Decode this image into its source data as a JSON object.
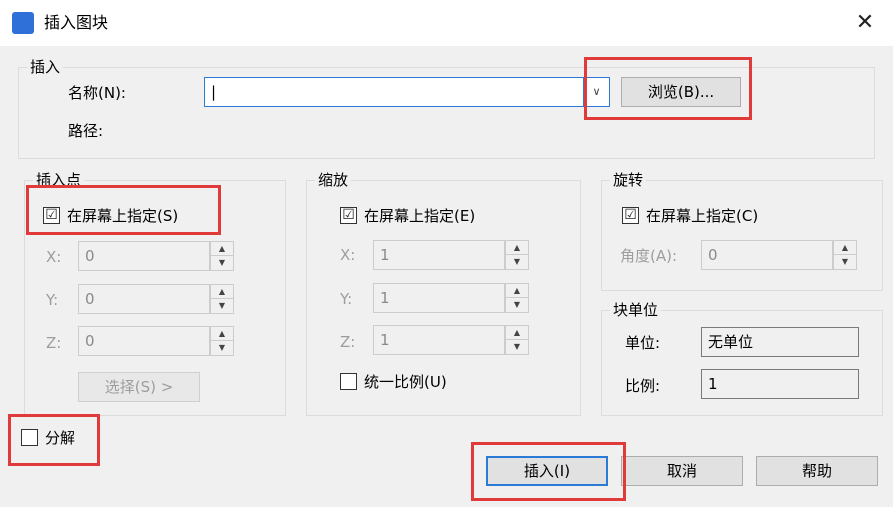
{
  "window": {
    "title": "插入图块",
    "close_glyph": "✕"
  },
  "insert_group": {
    "legend": "插入",
    "name_label": "名称(N):",
    "name_value": "|",
    "browse_label": "浏览(B)...",
    "path_label": "路径:"
  },
  "insert_point": {
    "legend": "插入点",
    "on_screen_label": "在屏幕上指定(S)",
    "on_screen_checked": "☑",
    "x_label": "X:",
    "x_value": "0",
    "y_label": "Y:",
    "y_value": "0",
    "z_label": "Z:",
    "z_value": "0",
    "select_label": "选择(S) >"
  },
  "scale": {
    "legend": "缩放",
    "on_screen_label": "在屏幕上指定(E)",
    "x_label": "X:",
    "x_value": "1",
    "y_label": "Y:",
    "y_value": "1",
    "z_label": "Z:",
    "z_value": "1",
    "uniform_label": "统一比例(U)"
  },
  "rotation": {
    "legend": "旋转",
    "on_screen_label": "在屏幕上指定(C)",
    "angle_label": "角度(A):",
    "angle_value": "0"
  },
  "block_unit": {
    "legend": "块单位",
    "unit_label": "单位:",
    "unit_value": "无单位",
    "ratio_label": "比例:",
    "ratio_value": "1"
  },
  "explode_label": "分解",
  "buttons": {
    "insert": "插入(I)",
    "cancel": "取消",
    "help": "帮助"
  },
  "icons": {
    "spin_up": "▲",
    "spin_down": "▼",
    "dropdown": "∨"
  },
  "colors": {
    "highlight": "#e03a3a",
    "focus": "#2b7bd6",
    "app_icon": "#2f6fd8"
  }
}
